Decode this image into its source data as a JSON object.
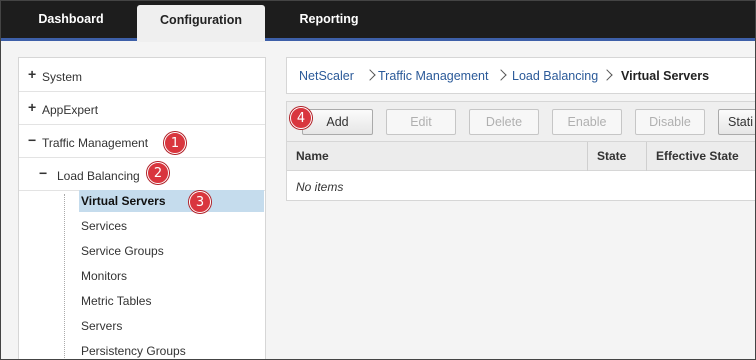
{
  "tabs": [
    {
      "label": "Dashboard"
    },
    {
      "label": "Configuration"
    },
    {
      "label": "Reporting"
    }
  ],
  "nav": {
    "sections": [
      {
        "sign": "+",
        "label": "System"
      },
      {
        "sign": "+",
        "label": "AppExpert"
      },
      {
        "sign": "−",
        "label": "Traffic Management"
      },
      {
        "sign": "−",
        "label": "Load Balancing"
      }
    ],
    "items": [
      {
        "label": "Virtual Servers"
      },
      {
        "label": "Services"
      },
      {
        "label": "Service Groups"
      },
      {
        "label": "Monitors"
      },
      {
        "label": "Metric Tables"
      },
      {
        "label": "Servers"
      },
      {
        "label": "Persistency Groups"
      }
    ]
  },
  "breadcrumb": {
    "items": [
      "NetScaler",
      "Traffic Management",
      "Load Balancing",
      "Virtual Servers"
    ]
  },
  "toolbar": {
    "buttons": [
      "Add",
      "Edit",
      "Delete",
      "Enable",
      "Disable",
      "Stati"
    ]
  },
  "table": {
    "columns": [
      "Name",
      "State",
      "Effective State"
    ],
    "empty_text": "No items"
  },
  "annotations": [
    "1",
    "2",
    "3",
    "4"
  ],
  "colors": {
    "topbar": "#1d1d1d",
    "accent_line": "#3d5fa8",
    "selected_row": "#c5dced",
    "badge": "#d9363e",
    "link": "#2b5a99"
  }
}
